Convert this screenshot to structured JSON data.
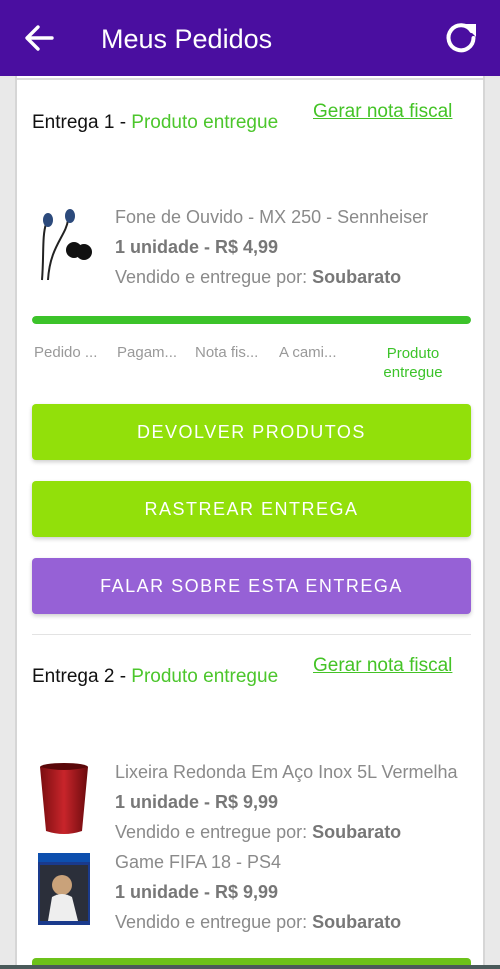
{
  "header": {
    "title": "Meus Pedidos",
    "background": "#4a0ea0"
  },
  "deliveries": [
    {
      "label": "Entrega 1",
      "status": "Produto entregue",
      "invoice_link": "Gerar nota fiscal",
      "products": [
        {
          "name": "Fone de Ouvido - MX 250 - Sennheiser",
          "qty": "1 unidade - R$ 4,99",
          "seller_prefix": "Vendido e entregue por:",
          "seller": "Soubarato",
          "icon": "earphones-icon"
        }
      ],
      "progress_percent": 100,
      "steps": [
        "Pedido ...",
        "Pagam...",
        "Nota fis...",
        "A cami...",
        "Produto entregue"
      ],
      "actions": {
        "return": "DEVOLVER PRODUTOS",
        "track": "RASTREAR ENTREGA",
        "talk": "FALAR SOBRE ESTA ENTREGA"
      }
    },
    {
      "label": "Entrega 2",
      "status": "Produto entregue",
      "invoice_link": "Gerar nota fiscal",
      "products": [
        {
          "name": "Lixeira Redonda Em Aço Inox 5L Vermelha",
          "qty": "1 unidade - R$ 9,99",
          "seller_prefix": "Vendido e entregue por:",
          "seller": "Soubarato",
          "icon": "trash-bin-icon"
        },
        {
          "name": "Game FIFA 18 - PS4",
          "qty": "1 unidade - R$ 9,99",
          "seller_prefix": "Vendido e entregue por:",
          "seller": "Soubarato",
          "icon": "game-cover-icon"
        }
      ]
    }
  ],
  "colors": {
    "accent_green": "#92e00a",
    "status_green": "#4cc62c",
    "purple_button": "#9661d6"
  }
}
